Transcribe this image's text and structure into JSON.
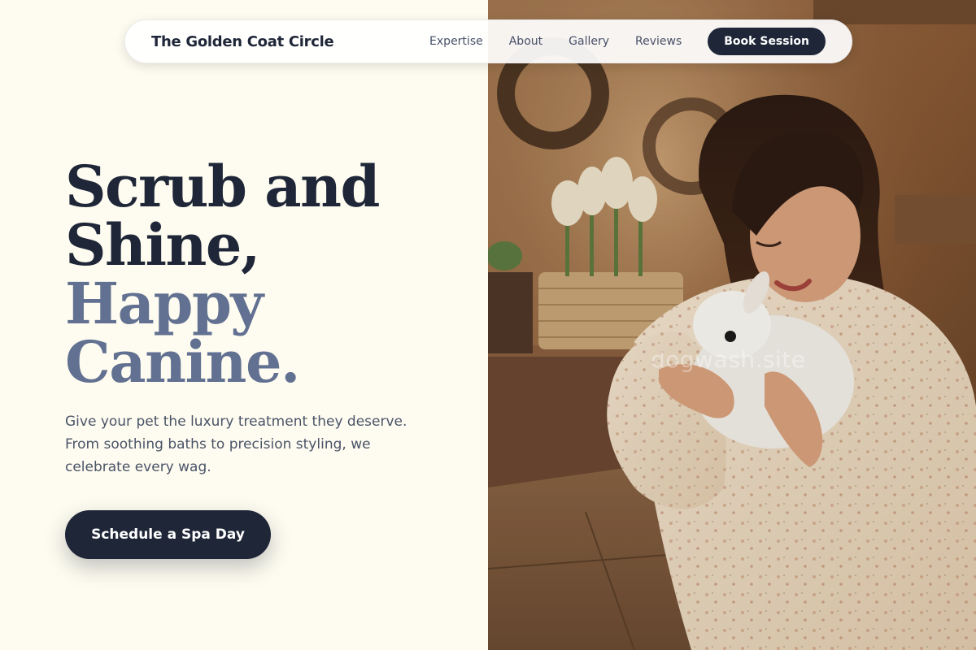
{
  "nav": {
    "brand": "The Golden Coat Circle",
    "links": [
      "Expertise",
      "About",
      "Gallery",
      "Reviews"
    ],
    "book_label": "Book Session"
  },
  "hero": {
    "line1": "Scrub and",
    "line2": "Shine,",
    "line3": "Happy",
    "line4": "Canine.",
    "subtext": "Give your pet the luxury treatment they deserve. From soothing baths to precision styling, we celebrate every wag.",
    "cta_label": "Schedule a Spa Day"
  },
  "photo": {
    "watermark": "dogwash.site"
  },
  "colors": {
    "background": "#fefcf0",
    "primary": "#1e2638",
    "accent_text": "#627191",
    "body_text": "#4a5468"
  }
}
